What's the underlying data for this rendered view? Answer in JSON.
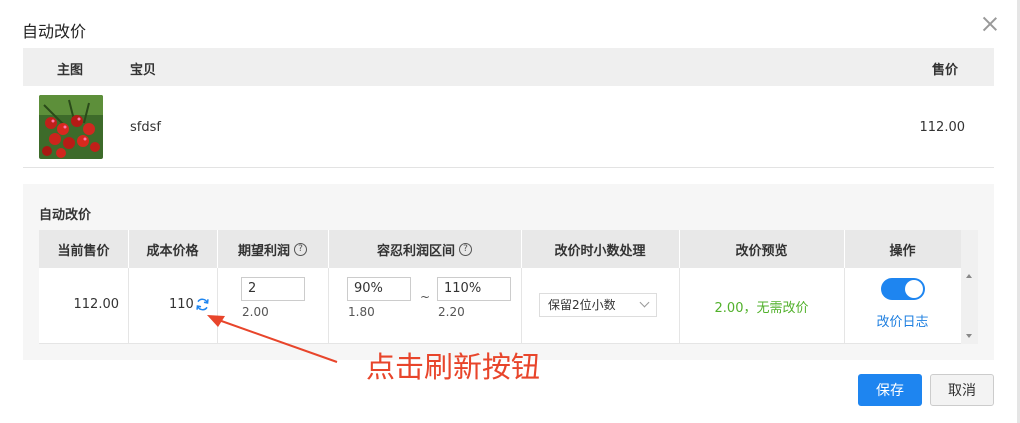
{
  "dialog": {
    "title": "自动改价"
  },
  "product_table": {
    "headers": {
      "image": "主图",
      "item": "宝贝",
      "price": "售价"
    },
    "row": {
      "name": "sfdsf",
      "price": "112.00"
    }
  },
  "auto_price": {
    "section_title": "自动改价",
    "columns": {
      "current_price": "当前售价",
      "cost_price": "成本价格",
      "expected_profit": "期望利润",
      "tolerance_range": "容忍利润区间",
      "decimal_handling": "改价时小数处理",
      "preview": "改价预览",
      "actions": "操作"
    },
    "row": {
      "current_price": "112.00",
      "cost_price": "110",
      "expected_profit_value": "2",
      "expected_profit_sub": "2.00",
      "range_min": "90%",
      "range_min_sub": "1.80",
      "range_sep": "~",
      "range_max": "110%",
      "range_max_sub": "2.20",
      "decimal_option": "保留2位小数",
      "preview_text": "2.00，无需改价",
      "toggle_on": true,
      "log_link": "改价日志"
    }
  },
  "annotation": {
    "text": "点击刷新按钮"
  },
  "footer": {
    "save": "保存",
    "cancel": "取消"
  },
  "colors": {
    "primary": "#1e85f0",
    "success": "#52b12c",
    "annotation": "#e8452b"
  }
}
